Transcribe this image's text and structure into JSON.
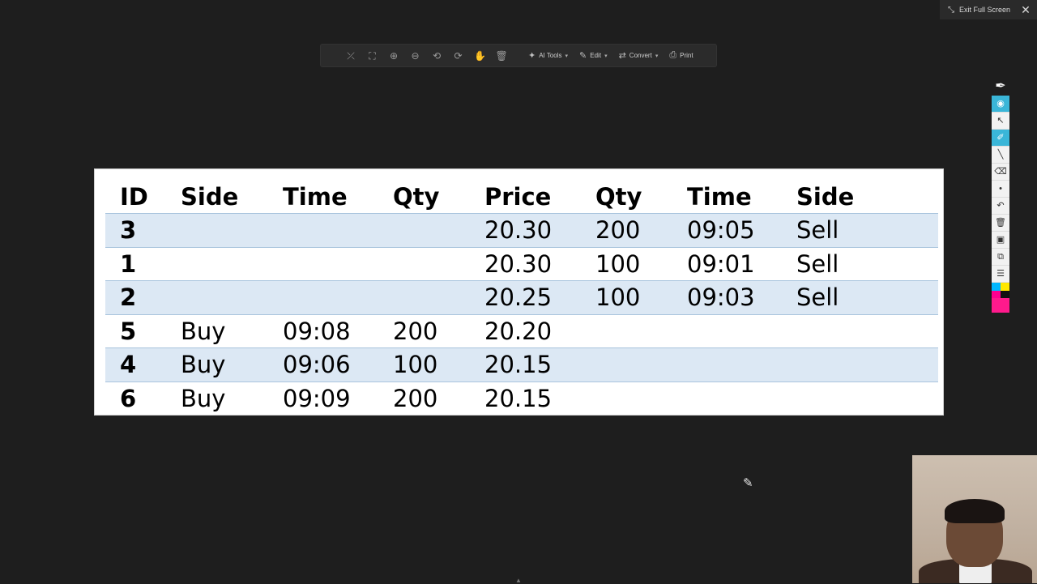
{
  "topbar": {
    "exit_label": "Exit Full Screen"
  },
  "toolbar": {
    "icons": [
      "exit-fit-icon",
      "fit-page-icon",
      "zoom-in-icon",
      "zoom-out-icon",
      "rotate-left-icon",
      "rotate-right-icon",
      "hand-icon",
      "delete-icon"
    ],
    "ai_tools_label": "AI Tools",
    "edit_label": "Edit",
    "convert_label": "Convert",
    "print_label": "Print"
  },
  "order_book": {
    "headers": [
      "ID",
      "Side",
      "Time",
      "Qty",
      "Price",
      "Qty",
      "Time",
      "Side"
    ],
    "rows": [
      [
        "3",
        "",
        "",
        "",
        "20.30",
        "200",
        "09:05",
        "Sell"
      ],
      [
        "1",
        "",
        "",
        "",
        "20.30",
        "100",
        "09:01",
        "Sell"
      ],
      [
        "2",
        "",
        "",
        "",
        "20.25",
        "100",
        "09:03",
        "Sell"
      ],
      [
        "5",
        "Buy",
        "09:08",
        "200",
        "20.20",
        "",
        "",
        ""
      ],
      [
        "4",
        "Buy",
        "09:06",
        "100",
        "20.15",
        "",
        "",
        ""
      ],
      [
        "6",
        "Buy",
        "09:09",
        "200",
        "20.15",
        "",
        "",
        ""
      ]
    ]
  },
  "annotation_tools": [
    "eye-icon",
    "select-arrow-icon",
    "highlighter-icon",
    "line-icon",
    "eraser-icon",
    "dot-icon",
    "undo-icon",
    "trash-icon",
    "camera-icon",
    "screenshot-icon",
    "clipboard-icon"
  ],
  "colors": {
    "background": "#1e1e1e",
    "row_highlight": "#dce8f4",
    "tool_active": "#3ab6d8",
    "swatch_cyan": "#00b7ff",
    "swatch_yellow": "#ffe800",
    "swatch_magenta": "#ff1a8c"
  }
}
